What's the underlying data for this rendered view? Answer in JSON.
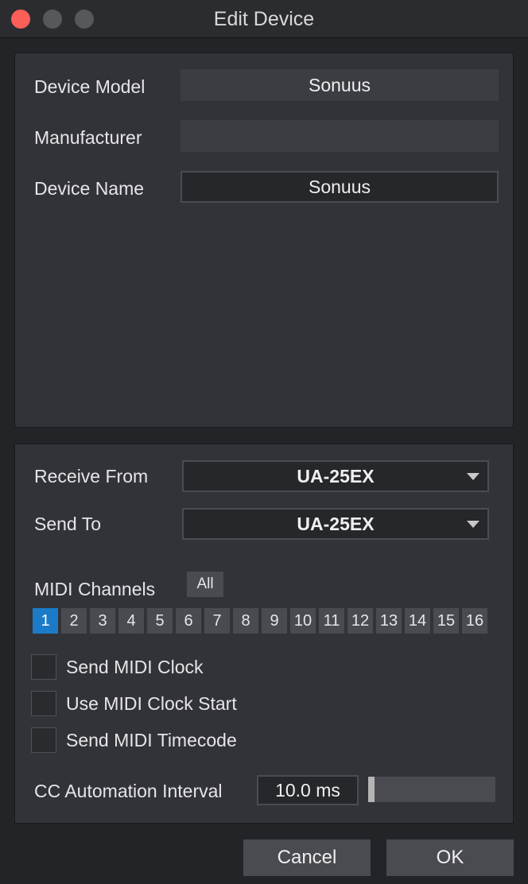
{
  "window": {
    "title": "Edit Device"
  },
  "device": {
    "model_label": "Device Model",
    "model_value": "Sonuus",
    "manufacturer_label": "Manufacturer",
    "manufacturer_value": "",
    "name_label": "Device Name",
    "name_value": "Sonuus"
  },
  "midi": {
    "receive_label": "Receive From",
    "receive_value": "UA-25EX",
    "send_label": "Send To",
    "send_value": "UA-25EX",
    "channels_label": "MIDI Channels",
    "all_label": "All",
    "channels": [
      "1",
      "2",
      "3",
      "4",
      "5",
      "6",
      "7",
      "8",
      "9",
      "10",
      "11",
      "12",
      "13",
      "14",
      "15",
      "16"
    ],
    "active_channel": "1",
    "options": [
      {
        "label": "Send MIDI Clock",
        "checked": false
      },
      {
        "label": "Use MIDI Clock Start",
        "checked": false
      },
      {
        "label": "Send MIDI Timecode",
        "checked": false
      }
    ],
    "cc_label": "CC Automation Interval",
    "cc_value": "10.0 ms",
    "cc_slider_fraction": 0.0
  },
  "buttons": {
    "cancel": "Cancel",
    "ok": "OK"
  },
  "colors": {
    "accent": "#1b7bc8",
    "close": "#fc5f57"
  }
}
